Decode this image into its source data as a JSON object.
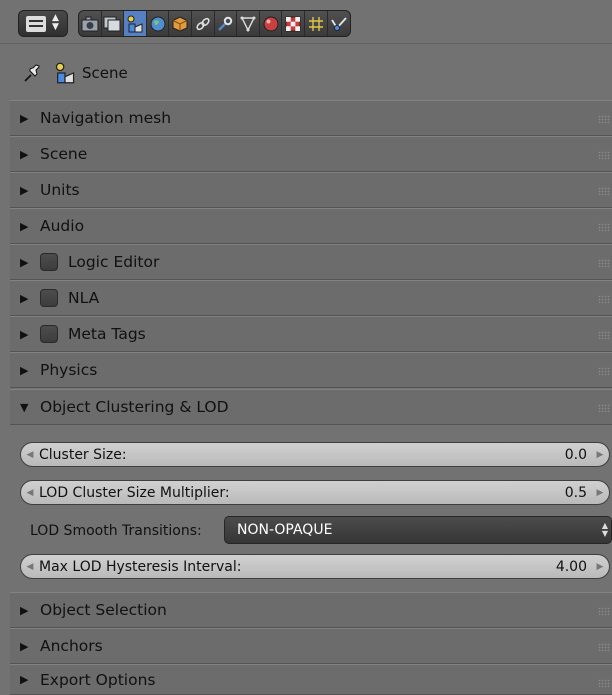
{
  "header": {
    "editor_type_icon": "properties-editor-icon",
    "context_tabs": [
      {
        "name": "render-tab",
        "icon": "camera-icon",
        "active": false
      },
      {
        "name": "render-layers-tab",
        "icon": "render-layers-icon",
        "active": false
      },
      {
        "name": "scene-tab",
        "icon": "scene-icon",
        "active": true
      },
      {
        "name": "world-tab",
        "icon": "world-icon",
        "active": false
      },
      {
        "name": "object-tab",
        "icon": "cube-icon",
        "active": false
      },
      {
        "name": "constraints-tab",
        "icon": "link-icon",
        "active": false
      },
      {
        "name": "modifiers-tab",
        "icon": "wrench-icon",
        "active": false
      },
      {
        "name": "data-tab",
        "icon": "mesh-data-icon",
        "active": false
      },
      {
        "name": "material-tab",
        "icon": "material-sphere-icon",
        "active": false
      },
      {
        "name": "texture-tab",
        "icon": "checker-texture-icon",
        "active": false
      },
      {
        "name": "particles-tab",
        "icon": "particles-icon",
        "active": false
      },
      {
        "name": "physics-tab",
        "icon": "physics-icon",
        "active": false
      }
    ]
  },
  "context": {
    "scene_label": "Scene"
  },
  "panels": [
    {
      "label": "Navigation mesh",
      "expanded": false,
      "has_checkbox": false
    },
    {
      "label": "Scene",
      "expanded": false,
      "has_checkbox": false
    },
    {
      "label": "Units",
      "expanded": false,
      "has_checkbox": false
    },
    {
      "label": "Audio",
      "expanded": false,
      "has_checkbox": false
    },
    {
      "label": "Logic Editor",
      "expanded": false,
      "has_checkbox": true
    },
    {
      "label": "NLA",
      "expanded": false,
      "has_checkbox": true
    },
    {
      "label": "Meta Tags",
      "expanded": false,
      "has_checkbox": true
    },
    {
      "label": "Physics",
      "expanded": false,
      "has_checkbox": false
    },
    {
      "label": "Object Clustering & LOD",
      "expanded": true,
      "has_checkbox": false
    },
    {
      "label": "Object Selection",
      "expanded": false,
      "has_checkbox": false
    },
    {
      "label": "Anchors",
      "expanded": false,
      "has_checkbox": false
    },
    {
      "label": "Export Options",
      "expanded": false,
      "has_checkbox": false
    }
  ],
  "lod": {
    "cluster_size_label": "Cluster Size:",
    "cluster_size_value": "0.0",
    "lod_multiplier_label": "LOD Cluster Size Multiplier:",
    "lod_multiplier_value": "0.5",
    "smooth_label": "LOD Smooth Transitions:",
    "smooth_value": "NON-OPAQUE",
    "hysteresis_label": "Max LOD Hysteresis Interval:",
    "hysteresis_value": "4.00"
  },
  "colors": {
    "active_tab": "#5680c2",
    "panel_bg": "#6c6c6c",
    "window_bg": "#727272"
  }
}
